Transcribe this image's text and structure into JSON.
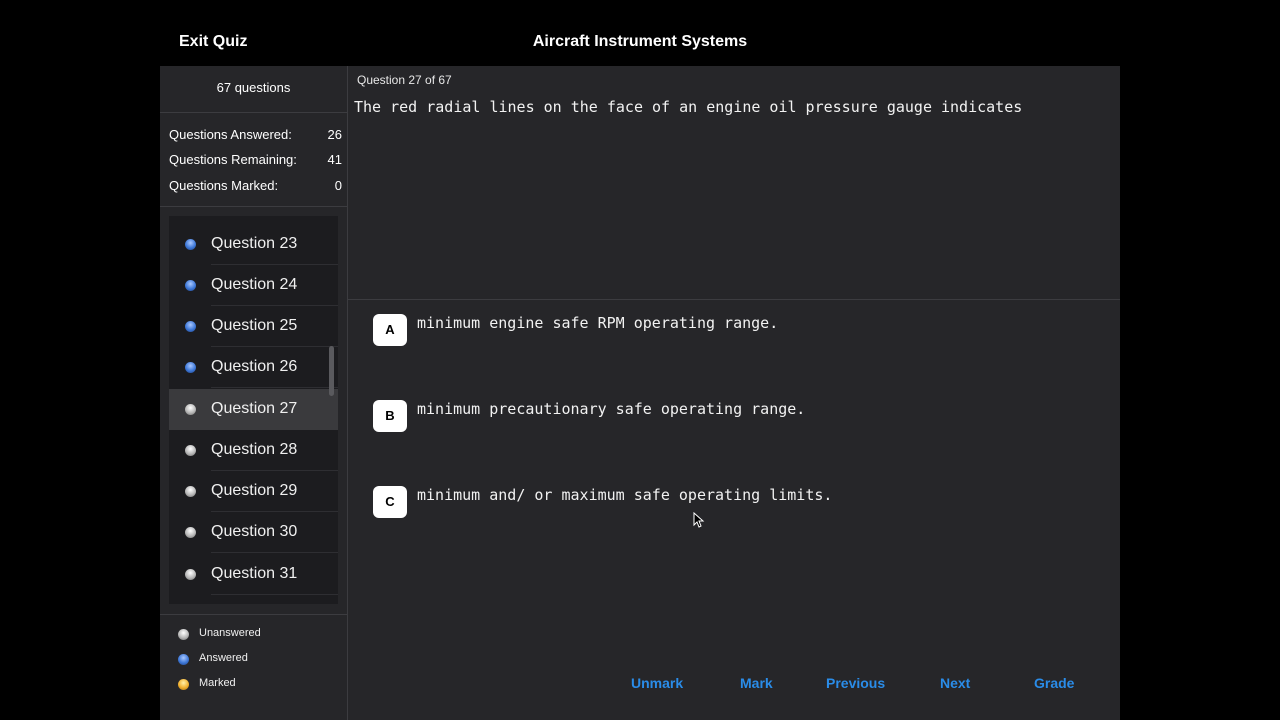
{
  "header": {
    "exit_label": "Exit Quiz",
    "title": "Aircraft Instrument Systems"
  },
  "sidebar": {
    "question_count": "67 questions",
    "stats": [
      {
        "label": "Questions Answered:",
        "value": "26"
      },
      {
        "label": "Questions Remaining:",
        "value": "41"
      },
      {
        "label": "Questions Marked:",
        "value": "0"
      }
    ],
    "questions": [
      {
        "label": "Question 23",
        "status": "answered"
      },
      {
        "label": "Question 24",
        "status": "answered"
      },
      {
        "label": "Question 25",
        "status": "answered"
      },
      {
        "label": "Question 26",
        "status": "answered"
      },
      {
        "label": "Question 27",
        "status": "unanswered",
        "current": true
      },
      {
        "label": "Question 28",
        "status": "unanswered"
      },
      {
        "label": "Question 29",
        "status": "unanswered"
      },
      {
        "label": "Question 30",
        "status": "unanswered"
      },
      {
        "label": "Question 31",
        "status": "unanswered"
      }
    ],
    "legend": [
      {
        "label": "Unanswered",
        "status": "unanswered"
      },
      {
        "label": "Answered",
        "status": "answered"
      },
      {
        "label": "Marked",
        "status": "marked"
      }
    ]
  },
  "main": {
    "question_number": "Question 27 of 67",
    "question_text": "The red radial lines on the face of an engine oil pressure gauge indicates",
    "options": [
      {
        "letter": "A",
        "text": "minimum engine safe RPM operating range."
      },
      {
        "letter": "B",
        "text": "minimum precautionary safe operating range."
      },
      {
        "letter": "C",
        "text": "minimum and/ or maximum safe operating limits."
      }
    ],
    "buttons": {
      "unmark": "Unmark",
      "mark": "Mark",
      "previous": "Previous",
      "next": "Next",
      "grade": "Grade"
    }
  },
  "colors": {
    "accent": "#2a8ce8",
    "panel": "#262629",
    "list_bg": "#1c1c1f",
    "selected_row": "#3a3a3d"
  }
}
